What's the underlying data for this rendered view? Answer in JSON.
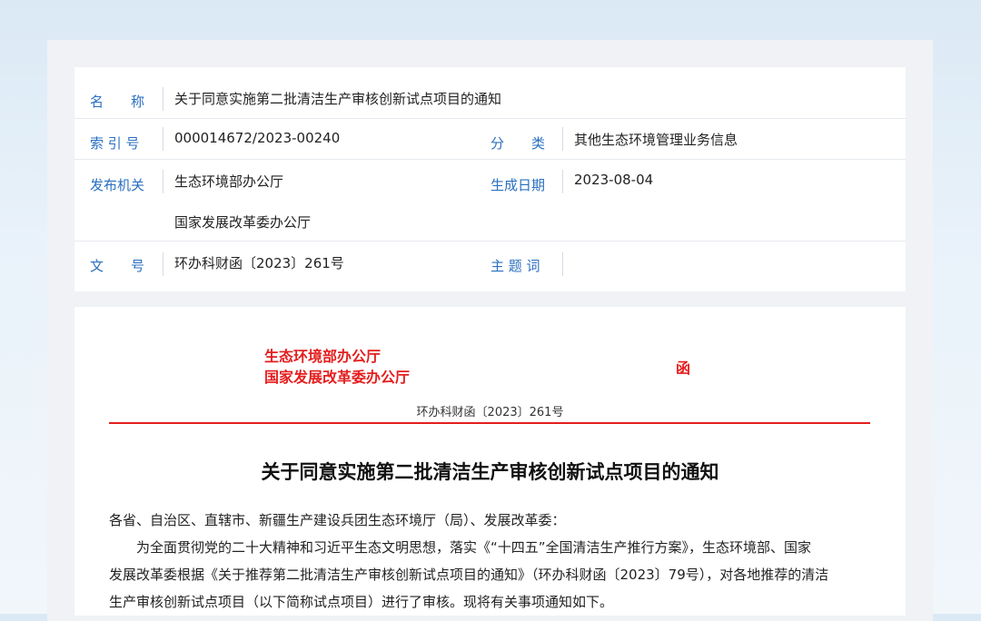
{
  "meta": {
    "name_label": "名　　称",
    "name_value": "关于同意实施第二批清洁生产审核创新试点项目的通知",
    "index_label": "索 引 号",
    "index_value": "000014672/2023-00240",
    "category_label": "分　　类",
    "category_value": "其他生态环境管理业务信息",
    "issuer_label": "发布机关",
    "issuer_values": [
      "生态环境部办公厅",
      "国家发展改革委办公厅"
    ],
    "date_label": "生成日期",
    "date_value": "2023-08-04",
    "docno_label": "文　　号",
    "docno_value": "环办科财函〔2023〕261号",
    "topic_label": "主 题 词",
    "topic_value": ""
  },
  "document": {
    "issuer_lines": [
      "生态环境部办公厅",
      "国家发展改革委办公厅"
    ],
    "han": "函",
    "doc_number": "环办科财函〔2023〕261号",
    "title": "关于同意实施第二批清洁生产审核创新试点项目的通知",
    "salutation": "各省、自治区、直辖市、新疆生产建设兵团生态环境厅（局）、发展改革委：",
    "body_lines": [
      "为全面贯彻党的二十大精神和习近平生态文明思想，落实《“十四五”全国清洁生产推行方案》，生态环境部、国家",
      "发展改革委根据《关于推荐第二批清洁生产审核创新试点项目的通知》（环办科财函〔2023〕79号），对各地推荐的清洁",
      "生产审核创新试点项目（以下简称试点项目）进行了审核。现将有关事项通知如下。"
    ]
  }
}
